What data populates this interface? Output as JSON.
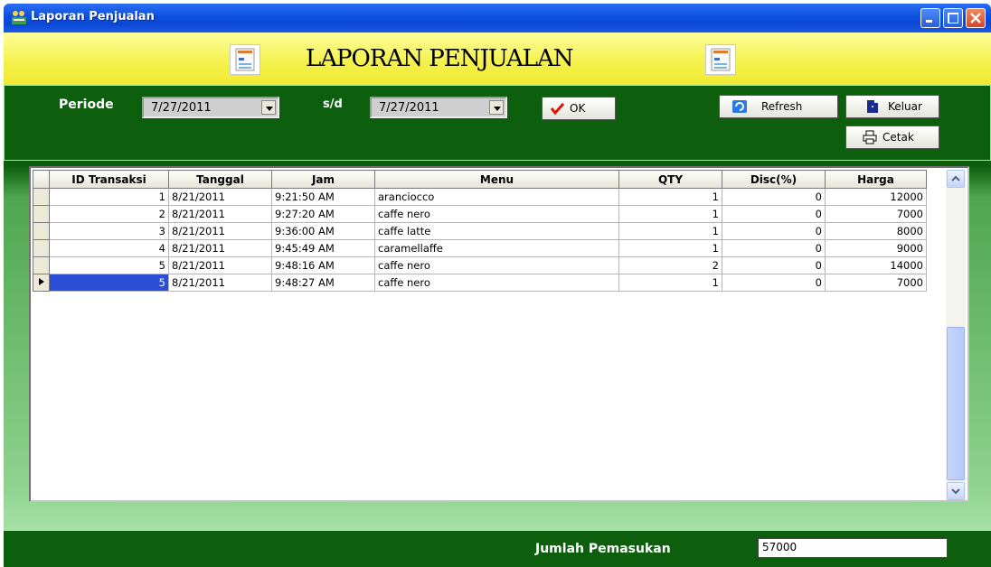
{
  "window": {
    "title": "Laporan Penjualan"
  },
  "header": {
    "title": "LAPORAN PENJUALAN"
  },
  "filter": {
    "periode_label": "Periode",
    "date_from": "7/27/2011",
    "sd_label": "s/d",
    "date_to": "7/27/2011",
    "ok_label": "OK"
  },
  "actions": {
    "refresh_label": "Refresh",
    "keluar_label": "Keluar",
    "cetak_label": "Cetak"
  },
  "table": {
    "columns": [
      "ID Transaksi",
      "Tanggal",
      "Jam",
      "Menu",
      "QTY",
      "Disc(%)",
      "Harga"
    ],
    "rows": [
      {
        "id": "1",
        "tanggal": "8/21/2011",
        "jam": "9:21:50 AM",
        "menu": "aranciocco",
        "qty": "1",
        "disc": "0",
        "harga": "12000"
      },
      {
        "id": "2",
        "tanggal": "8/21/2011",
        "jam": "9:27:20 AM",
        "menu": "caffe nero",
        "qty": "1",
        "disc": "0",
        "harga": "7000"
      },
      {
        "id": "3",
        "tanggal": "8/21/2011",
        "jam": "9:36:00 AM",
        "menu": "caffe latte",
        "qty": "1",
        "disc": "0",
        "harga": "8000"
      },
      {
        "id": "4",
        "tanggal": "8/21/2011",
        "jam": "9:45:49 AM",
        "menu": "caramellaffe",
        "qty": "1",
        "disc": "0",
        "harga": "9000"
      },
      {
        "id": "5",
        "tanggal": "8/21/2011",
        "jam": "9:48:16 AM",
        "menu": "caffe nero",
        "qty": "2",
        "disc": "0",
        "harga": "14000"
      },
      {
        "id": "5",
        "tanggal": "8/21/2011",
        "jam": "9:48:27 AM",
        "menu": "caffe nero",
        "qty": "1",
        "disc": "0",
        "harga": "7000"
      }
    ],
    "selected_row": 5
  },
  "footer": {
    "total_label": "Jumlah Pemasukan",
    "total_value": "57000"
  },
  "colors": {
    "title_blue": "#0a4fe0",
    "header_yellow": "#f4f04a",
    "panel_green": "#0d5e0d",
    "light_green": "#a7e0a7",
    "selection_blue": "#2a4fd6"
  },
  "icons": [
    "app-icon",
    "document-icon",
    "checkmark-icon",
    "refresh-icon",
    "exit-door-icon",
    "printer-icon",
    "row-pointer-icon"
  ]
}
